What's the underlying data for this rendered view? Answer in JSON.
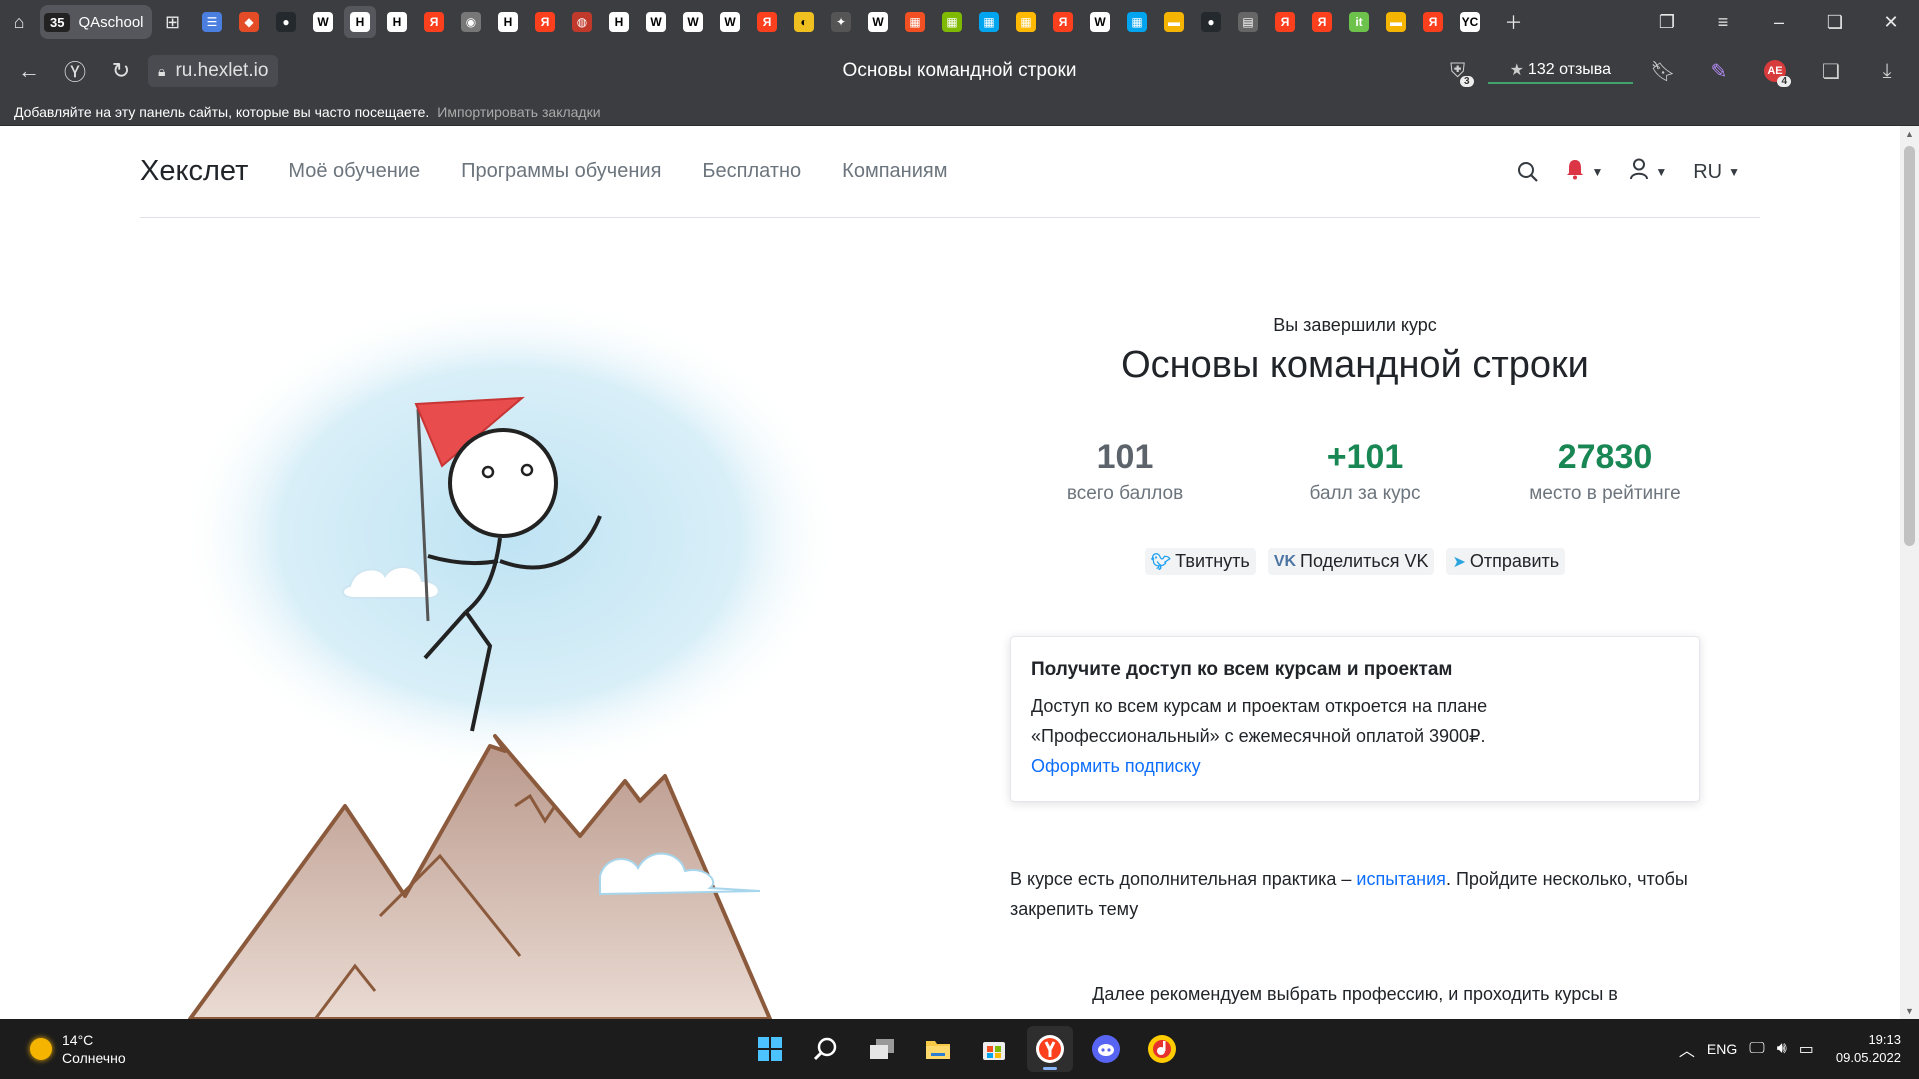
{
  "browser": {
    "tab_group_count": "35",
    "tab_group_name": "QAschool",
    "tabs": [
      {
        "glyph": "☰",
        "bg": "#4a7fe0"
      },
      {
        "glyph": "◆",
        "bg": "#e34c26"
      },
      {
        "glyph": "●",
        "bg": "#24292e"
      },
      {
        "glyph": "W",
        "bg": "#ffffff",
        "fg": "#000"
      },
      {
        "glyph": "H",
        "bg": "#ffffff",
        "fg": "#000"
      },
      {
        "glyph": "H",
        "bg": "#ffffff",
        "fg": "#000"
      },
      {
        "glyph": "Я",
        "bg": "#fc3f1d"
      },
      {
        "glyph": "◉",
        "bg": "#777777"
      },
      {
        "glyph": "H",
        "bg": "#ffffff",
        "fg": "#000"
      },
      {
        "glyph": "Я",
        "bg": "#fc3f1d"
      },
      {
        "glyph": "◍",
        "bg": "#c0392b"
      },
      {
        "glyph": "H",
        "bg": "#ffffff",
        "fg": "#000"
      },
      {
        "glyph": "W",
        "bg": "#ffffff",
        "fg": "#000"
      },
      {
        "glyph": "W",
        "bg": "#ffffff",
        "fg": "#000"
      },
      {
        "glyph": "W",
        "bg": "#ffffff",
        "fg": "#000"
      },
      {
        "glyph": "Я",
        "bg": "#fc3f1d"
      },
      {
        "glyph": "◐",
        "bg": "#f0c020",
        "fg": "#000"
      },
      {
        "glyph": "✦",
        "bg": "#555555"
      },
      {
        "glyph": "W",
        "bg": "#ffffff",
        "fg": "#000"
      },
      {
        "glyph": "▦",
        "bg": "#f25022"
      },
      {
        "glyph": "▦",
        "bg": "#7fba00"
      },
      {
        "glyph": "▦",
        "bg": "#00a4ef"
      },
      {
        "glyph": "▦",
        "bg": "#ffb900"
      },
      {
        "glyph": "Я",
        "bg": "#fc3f1d"
      },
      {
        "glyph": "W",
        "bg": "#ffffff",
        "fg": "#000"
      },
      {
        "glyph": "▦",
        "bg": "#00a4ef"
      },
      {
        "glyph": "▬",
        "bg": "#f4b400"
      },
      {
        "glyph": "●",
        "bg": "#24292e"
      },
      {
        "glyph": "▤",
        "bg": "#666666"
      },
      {
        "glyph": "Я",
        "bg": "#fc3f1d"
      },
      {
        "glyph": "Я",
        "bg": "#fc3f1d"
      },
      {
        "glyph": "it",
        "bg": "#6cc24a"
      },
      {
        "glyph": "▬",
        "bg": "#f4b400"
      },
      {
        "glyph": "Я",
        "bg": "#fc3f1d"
      },
      {
        "glyph": "YC",
        "bg": "#ffffff",
        "fg": "#000"
      }
    ],
    "url": "ru.hexlet.io",
    "page_title": "Основы командной строки",
    "reviews_label": "132 отзыва",
    "protect_badge": "3",
    "ext_badge": "4",
    "bookmarks_hint": "Добавляйте на эту панель сайты, которые вы часто посещаете.",
    "bookmarks_import": "Импортировать закладки"
  },
  "site": {
    "brand": "Хекслет",
    "nav": [
      "Моё обучение",
      "Программы обучения",
      "Бесплатно",
      "Компаниям"
    ],
    "lang": "RU"
  },
  "course": {
    "completed_label": "Вы завершили курс",
    "title": "Основы командной строки",
    "stats": [
      {
        "value": "101",
        "label": "всего баллов"
      },
      {
        "value": "+101",
        "label": "балл за курс"
      },
      {
        "value": "27830",
        "label": "место в рейтинге"
      }
    ],
    "share": {
      "twitter": "Твитнуть",
      "vk": "Поделиться VK",
      "telegram": "Отправить"
    }
  },
  "access_card": {
    "title": "Получите доступ ко всем курсам и проектам",
    "body": "Доступ ко всем курсам и проектам откроется на плане «Профессиональный» с ежемесячной оплатой 3900₽.",
    "link": "Оформить подписку"
  },
  "practice": {
    "before": "В курсе есть дополнительная практика – ",
    "link": "испытания",
    "after": ". Пройдите несколько, чтобы закрепить тему"
  },
  "recommend": "Далее рекомендуем выбрать профессию, и проходить курсы в",
  "taskbar": {
    "temperature": "14°C",
    "weather": "Солнечно",
    "lang": "ENG",
    "time": "19:13",
    "date": "09.05.2022"
  },
  "colors": {
    "accent_green": "#198754",
    "link_blue": "#0d6efd",
    "bell_red": "#dc3545"
  }
}
